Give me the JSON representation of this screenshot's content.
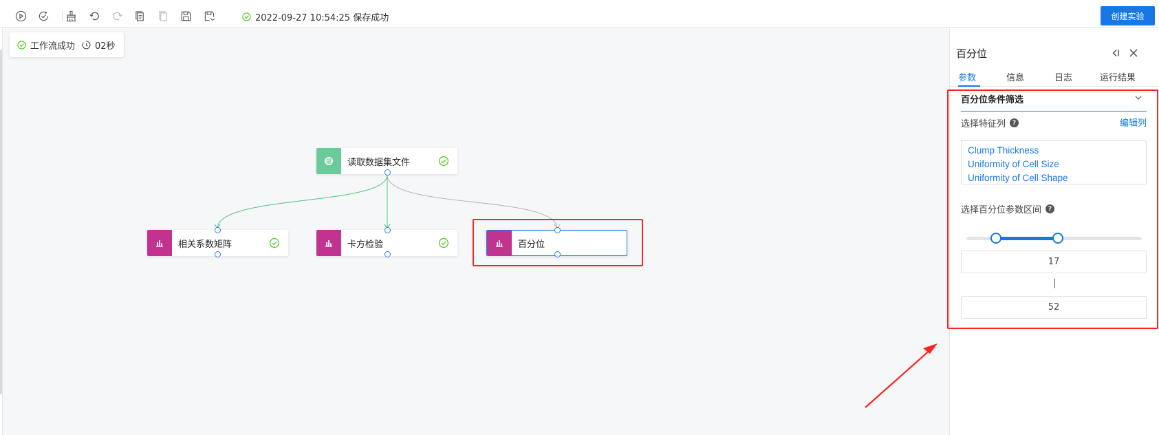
{
  "toolbar": {
    "icons": [
      "play-icon",
      "validate-icon",
      "brush-icon",
      "undo-icon",
      "redo-icon",
      "copy-icon",
      "paste-icon",
      "save-icon",
      "save-as-icon"
    ],
    "save_status": "2022-09-27 10:54:25 保存成功",
    "create_experiment_label": "创建实验"
  },
  "workflow_status": {
    "text": "工作流成功",
    "duration": "02秒"
  },
  "nodes": [
    {
      "label": "读取数据集文件",
      "type": "dataset",
      "icon_color": "#6cc99a",
      "status": "success"
    },
    {
      "label": "相关系数矩阵",
      "type": "analysis",
      "icon_color": "#c2338f",
      "status": "success"
    },
    {
      "label": "卡方检验",
      "type": "analysis",
      "icon_color": "#c2338f",
      "status": "success"
    },
    {
      "label": "百分位",
      "type": "analysis",
      "icon_color": "#c2338f",
      "status": "selected"
    }
  ],
  "panel": {
    "title": "百分位",
    "tabs": [
      "参数",
      "信息",
      "日志",
      "运行结果"
    ],
    "active_tab": "参数",
    "section_title": "百分位条件筛选",
    "feature_label": "选择特征列",
    "edit_columns_label": "编辑列",
    "selected_columns": [
      "Clump Thickness",
      "Uniformity of Cell Size",
      "Uniformity of Cell Shape"
    ],
    "range_label": "选择百分位参数区间",
    "range_min": "17",
    "range_separator": "|",
    "range_max": "52",
    "slider": {
      "min": 0,
      "max": 100,
      "low": 17,
      "high": 52
    }
  },
  "colors": {
    "accent": "#1677e5",
    "success": "#52c41a",
    "highlight": "#ff2222"
  }
}
